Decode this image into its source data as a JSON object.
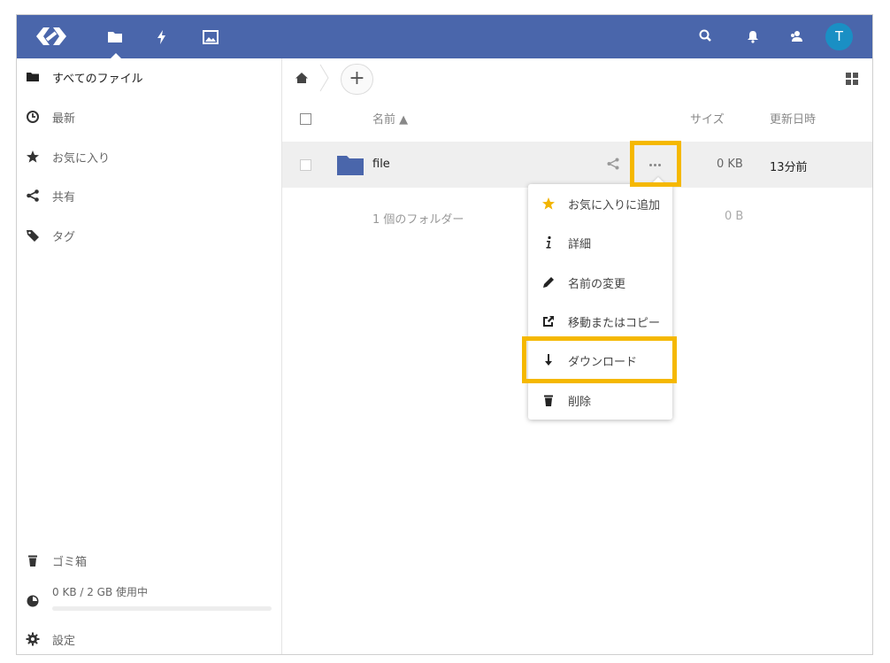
{
  "topbar": {
    "apps": [
      {
        "name": "files-app",
        "icon": "folder-icon",
        "active": true
      },
      {
        "name": "activity-app",
        "icon": "lightning-icon",
        "active": false
      },
      {
        "name": "gallery-app",
        "icon": "image-icon",
        "active": false
      }
    ],
    "right_icons": [
      "search-icon",
      "bell-icon",
      "contacts-icon"
    ],
    "avatar_letter": "T",
    "brand_color": "#4a66ab",
    "avatar_color": "#1a8fc4"
  },
  "sidebar": {
    "items": [
      {
        "label": "すべてのファイル",
        "icon": "folder-icon"
      },
      {
        "label": "最新",
        "icon": "clock-icon"
      },
      {
        "label": "お気に入り",
        "icon": "star-icon"
      },
      {
        "label": "共有",
        "icon": "share-icon"
      },
      {
        "label": "タグ",
        "icon": "tag-icon"
      }
    ],
    "trash_label": "ゴミ箱",
    "quota_label": "0 KB / 2 GB 使用中",
    "quota_fraction": 0,
    "settings_label": "設定"
  },
  "main": {
    "breadcrumb": {
      "home_icon": "home-icon",
      "add_label": "+"
    },
    "columns": {
      "name": "名前 ▲",
      "size": "サイズ",
      "modified": "更新日時"
    },
    "files": [
      {
        "name": "file",
        "type": "folder",
        "size": "0 KB",
        "modified": "13分前"
      }
    ],
    "summary": {
      "label": "1 個のフォルダー",
      "size": "0 B"
    },
    "folder_color": "#4a66ab"
  },
  "menu": {
    "items": [
      {
        "label": "お気に入りに追加",
        "icon": "star-icon"
      },
      {
        "label": "詳細",
        "icon": "info-icon"
      },
      {
        "label": "名前の変更",
        "icon": "pencil-icon"
      },
      {
        "label": "移動またはコピー",
        "icon": "external-link-icon"
      },
      {
        "label": "ダウンロード",
        "icon": "download-icon"
      },
      {
        "label": "削除",
        "icon": "trash-icon"
      }
    ]
  },
  "highlight_color": "#f5b800"
}
